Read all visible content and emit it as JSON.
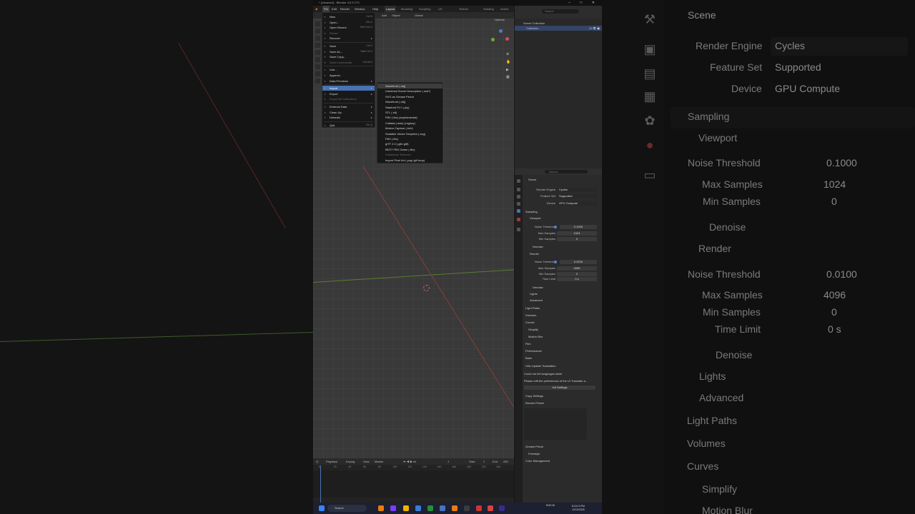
{
  "window": {
    "title": "* (Unsaved) - Blender 4.5.3 LTS"
  },
  "menubar": {
    "items": [
      "File",
      "Edit",
      "Render",
      "Window",
      "Help"
    ],
    "workspaces": [
      "Layout",
      "Modeling",
      "Sculpting",
      "UV Editing",
      "Texture Paint",
      "Shading",
      "Anima"
    ],
    "scene": "Scene",
    "view_layer": "ViewLayer"
  },
  "viewport": {
    "header": [
      "Add",
      "Object",
      "Global"
    ],
    "options": "Options"
  },
  "file_menu": {
    "items": [
      {
        "label": "New",
        "shortcut": "Ctrl N",
        "submenu": true
      },
      {
        "label": "Open...",
        "shortcut": "Ctrl O"
      },
      {
        "label": "Open Recent",
        "shortcut": "Shift Ctrl O",
        "submenu": true
      },
      {
        "label": "Revert",
        "disabled": true
      },
      {
        "label": "Recover",
        "submenu": true
      },
      {
        "label": "Save",
        "shortcut": "Ctrl S"
      },
      {
        "label": "Save As...",
        "shortcut": "Shift Ctrl S"
      },
      {
        "label": "Save Copy..."
      },
      {
        "label": "Save Incremental",
        "shortcut": "Ctrl Alt S",
        "disabled": true
      },
      {
        "label": "Link..."
      },
      {
        "label": "Append..."
      },
      {
        "label": "Data Previews",
        "submenu": true
      },
      {
        "label": "Import",
        "submenu": true
      },
      {
        "label": "Export",
        "submenu": true
      },
      {
        "label": "Export All Collections",
        "disabled": true
      },
      {
        "label": "External Data",
        "submenu": true
      },
      {
        "label": "Clean Up",
        "submenu": true
      },
      {
        "label": "Defaults",
        "submenu": true
      },
      {
        "label": "Quit",
        "shortcut": "Ctrl Q"
      }
    ]
  },
  "import_submenu": {
    "items": [
      "Wavefront (.obj)",
      "Universal Scene Description (.usd*)",
      "SVG as Grease Pencil",
      "Wavefront (.obj)",
      "Stanford PLY (.ply)",
      "STL (.stl)",
      "FBX (.fbx) (experimental)",
      "Collada (.dae) (Legacy)",
      "Motion Capture (.bvh)",
      "Scalable Vector Graphics (.svg)",
      "FBX (.fbx)",
      "glTF 2.0 (.glb/.gltf)",
      "BEST FBX Game (.fbx)",
      "Substance Textures...",
      "Import Pixel Art (.png/.gif/.bmp)"
    ]
  },
  "outliner": {
    "rows": [
      "Scene Collection",
      "Collection"
    ],
    "search_placeholder": "Search"
  },
  "properties": {
    "search_placeholder": "Search",
    "context": "Scene",
    "render_engine_label": "Render Engine",
    "render_engine": "Cycles",
    "feature_set_label": "Feature Set",
    "feature_set": "Supported",
    "device_label": "Device",
    "device": "GPU Compute",
    "sampling": "Sampling",
    "viewport": "Viewport",
    "noise_threshold_label": "Noise Threshold",
    "viewport_noise_threshold": "0.1000",
    "max_samples_label": "Max Samples",
    "viewport_max_samples": "1024",
    "min_samples_label": "Min Samples",
    "viewport_min_samples": "0",
    "denoise": "Denoise",
    "render": "Render",
    "render_noise_threshold": "0.0100",
    "render_max_samples": "4096",
    "render_min_samples": "0",
    "time_limit_label": "Time Limit",
    "time_limit": "0 s",
    "lights": "Lights",
    "advanced": "Advanced",
    "light_paths": "Light Paths",
    "volumes": "Volumes",
    "curves": "Curves",
    "simplify": "Simplify",
    "motion_blur": "Motion Blur",
    "film": "Film",
    "performance": "Performance",
    "bake": "Bake",
    "i18n_panel": "I18n Update Translation",
    "i18n_msg1": "Could not init languages data!",
    "i18n_msg2": "Please edit the preferences of the UI Translate a...",
    "init_settings": "Init Settings",
    "copy_settings": "Copy Settings",
    "render_preset": "Render Preset",
    "grease_pencil": "Grease Pencil",
    "freestyle": "Freestyle",
    "color_management": "Color Management"
  },
  "timeline": {
    "header": [
      "Playback",
      "Keying",
      "View",
      "Marker"
    ],
    "current_frame": "1",
    "start_label": "Start",
    "start": "1",
    "end_label": "End",
    "end": "250",
    "ticks": [
      "0",
      "20",
      "40",
      "60",
      "80",
      "100",
      "120",
      "140",
      "160",
      "180",
      "200",
      "220",
      "240"
    ]
  },
  "taskbar": {
    "search": "Search",
    "lang": "ENG\nIN",
    "time": "8:15:13 PM",
    "date": "12/10/2025"
  },
  "background_zoom": {
    "context": "Scene",
    "render_engine_label": "Render Engine",
    "render_engine": "Cycles",
    "feature_set_label": "Feature Set",
    "feature_set": "Supported",
    "device_label": "Device",
    "device": "GPU Compute",
    "sampling": "Sampling",
    "viewport": "Viewport",
    "noise_threshold_label": "Noise Threshold",
    "viewport_noise_threshold": "0.1000",
    "max_samples_label": "Max Samples",
    "viewport_max_samples": "1024",
    "min_samples_label": "Min Samples",
    "viewport_min_samples": "0",
    "denoise": "Denoise",
    "render": "Render",
    "render_noise_threshold": "0.0100",
    "render_max_samples": "4096",
    "render_min_samples": "0",
    "time_limit_label": "Time Limit",
    "time_limit": "0 s",
    "lights": "Lights",
    "advanced": "Advanced",
    "light_paths": "Light Paths",
    "volumes": "Volumes",
    "curves": "Curves",
    "simplify": "Simplify",
    "motion_blur": "Motion Blur"
  },
  "colors": {
    "accent": "#4772b3",
    "x_axis": "#c04545",
    "y_axis": "#7aa83a"
  }
}
